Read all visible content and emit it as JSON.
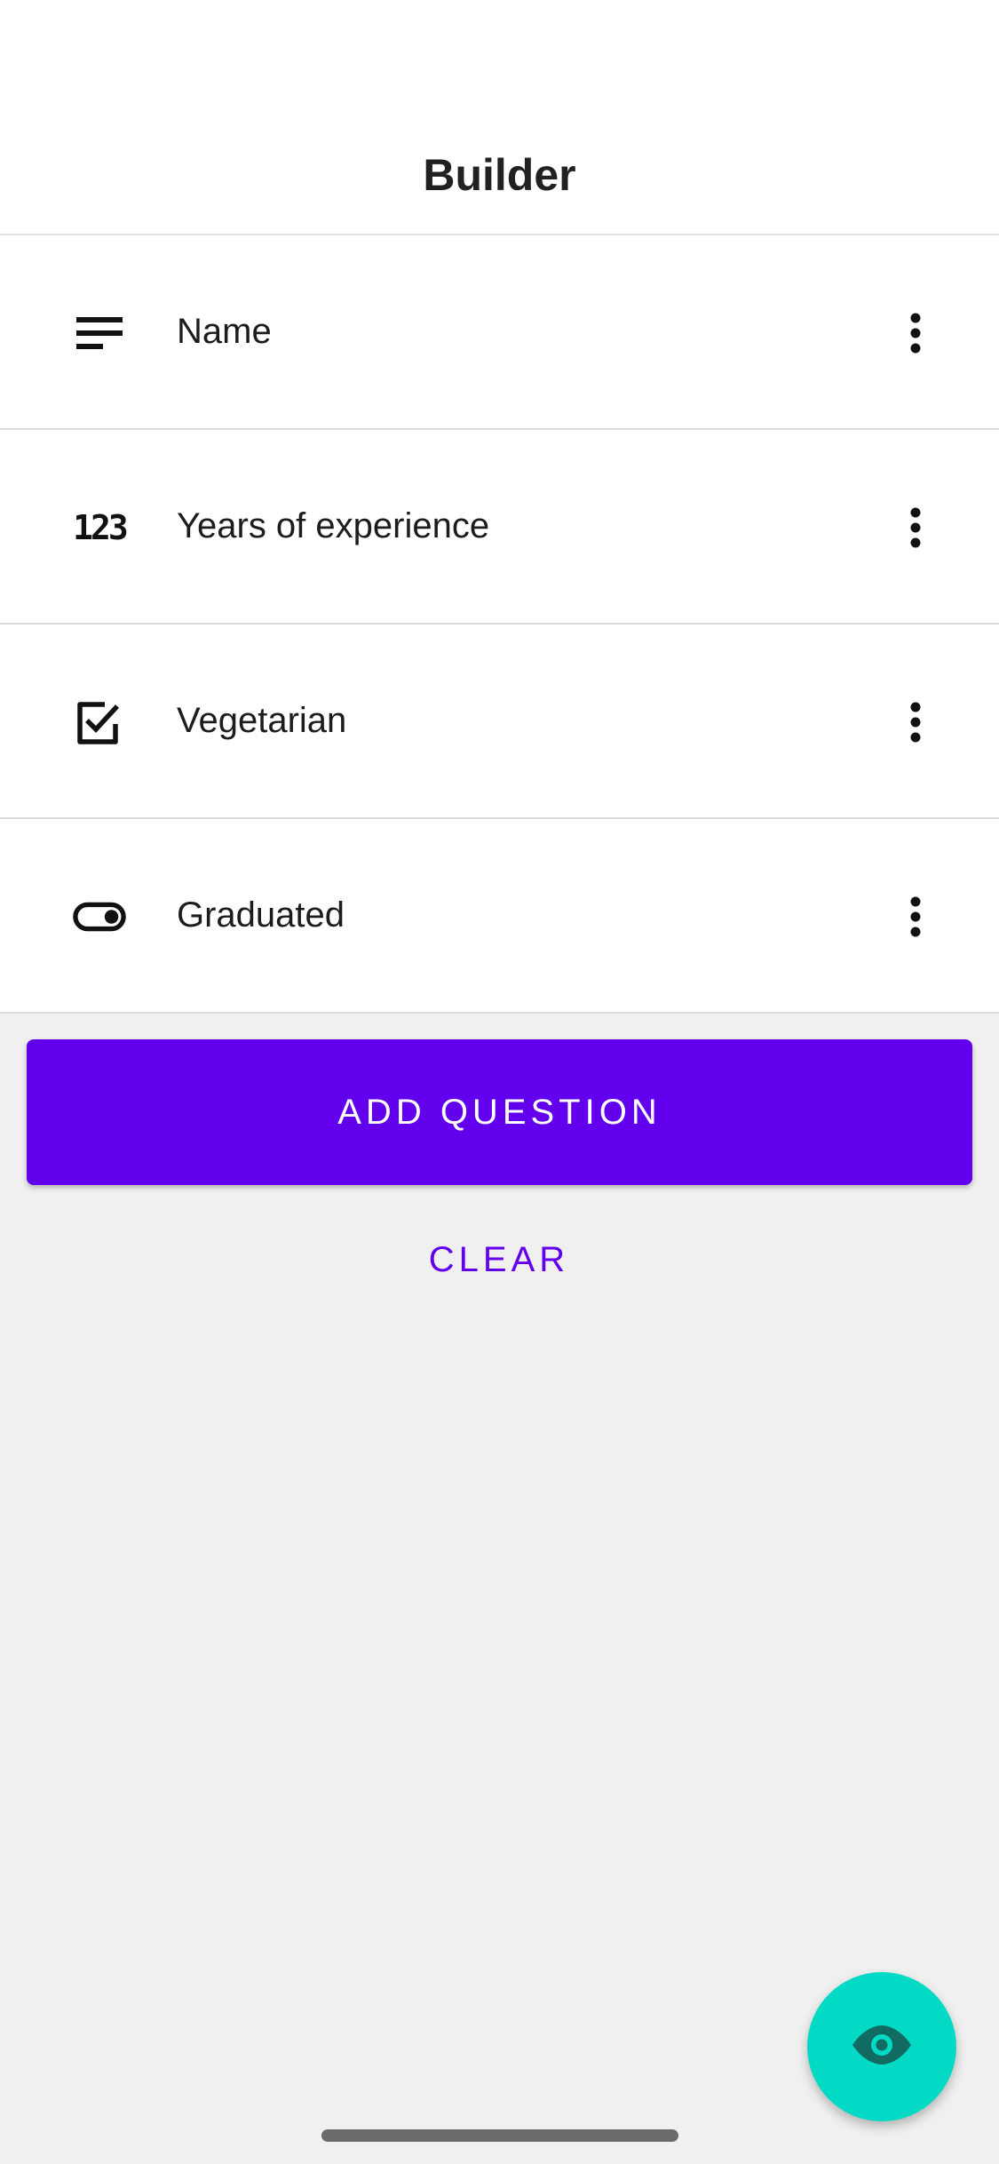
{
  "header": {
    "title": "Builder"
  },
  "questions": [
    {
      "label": "Name",
      "icon": "short-text-icon"
    },
    {
      "label": "Years of experience",
      "icon": "number-icon",
      "icon_text": "123"
    },
    {
      "label": "Vegetarian",
      "icon": "checkbox-icon"
    },
    {
      "label": "Graduated",
      "icon": "toggle-icon"
    }
  ],
  "more_icon": "more-vert-icon",
  "actions": {
    "add_question": "ADD QUESTION",
    "clear": "CLEAR"
  },
  "fab": {
    "icon": "eye-icon"
  },
  "colors": {
    "primary": "#6200ee",
    "secondary": "#03dac5",
    "background": "#f0f0f0",
    "surface": "#ffffff"
  }
}
